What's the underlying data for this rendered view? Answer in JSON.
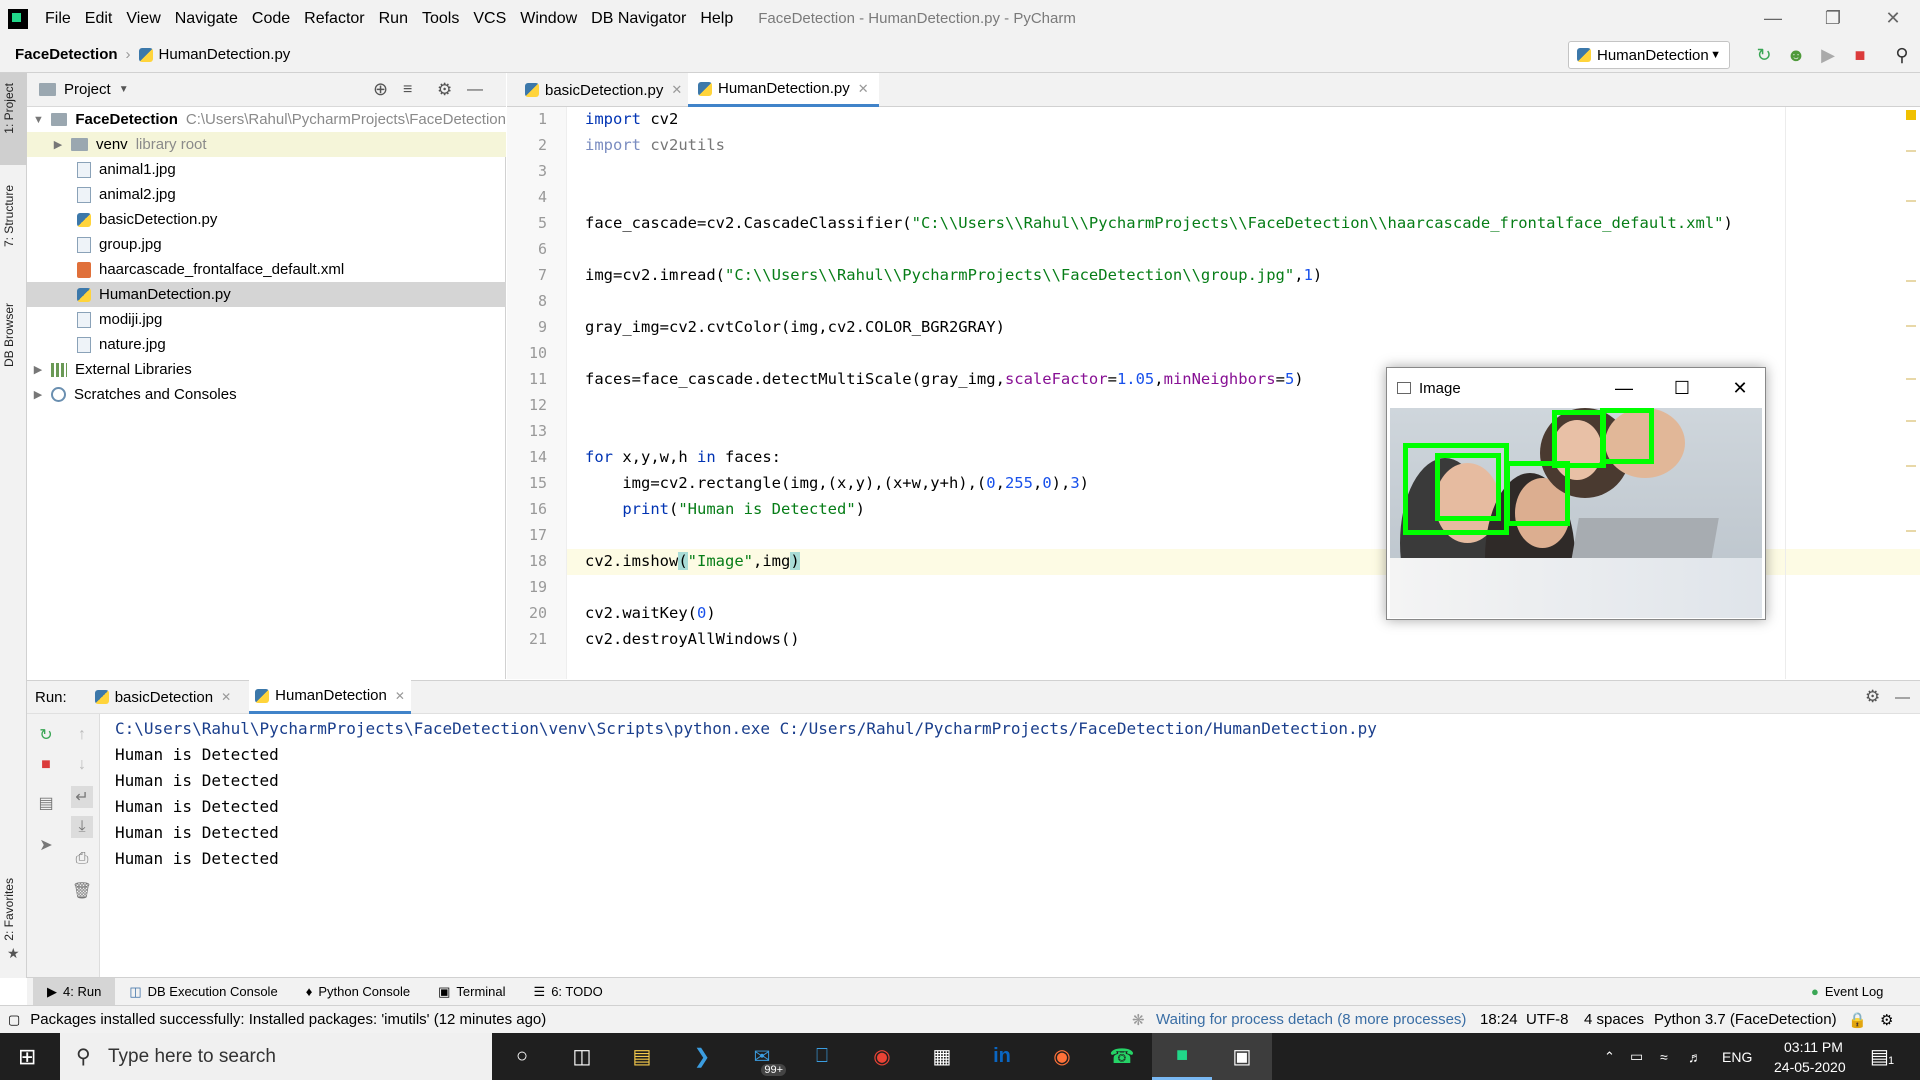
{
  "window": {
    "title": "FaceDetection - HumanDetection.py - PyCharm"
  },
  "menu": [
    "File",
    "Edit",
    "View",
    "Navigate",
    "Code",
    "Refactor",
    "Run",
    "Tools",
    "VCS",
    "Window",
    "DB Navigator",
    "Help"
  ],
  "nav": {
    "project": "FaceDetection",
    "file": "HumanDetection.py",
    "run_config": "HumanDetection"
  },
  "left_strip": {
    "project": "1: Project",
    "structure": "7: Structure",
    "db_browser": "DB Browser",
    "favorites": "2: Favorites"
  },
  "project_panel": {
    "title": "Project",
    "root_name": "FaceDetection",
    "root_path": "C:\\Users\\Rahul\\PycharmProjects\\FaceDetection",
    "venv": "venv",
    "venv_note": "library root",
    "files": [
      "animal1.jpg",
      "animal2.jpg",
      "basicDetection.py",
      "group.jpg",
      "haarcascade_frontalface_default.xml",
      "HumanDetection.py",
      "modiji.jpg",
      "nature.jpg"
    ],
    "external": "External Libraries",
    "scratches": "Scratches and Consoles"
  },
  "editor": {
    "tabs": [
      "basicDetection.py",
      "HumanDetection.py"
    ],
    "line_numbers": [
      "1",
      "2",
      "3",
      "4",
      "5",
      "6",
      "7",
      "8",
      "9",
      "10",
      "11",
      "12",
      "13",
      "14",
      "15",
      "16",
      "17",
      "18",
      "19",
      "20",
      "21"
    ]
  },
  "image_window": {
    "title": "Image"
  },
  "run": {
    "label": "Run:",
    "tabs": [
      "basicDetection",
      "HumanDetection"
    ],
    "command": "C:\\Users\\Rahul\\PycharmProjects\\FaceDetection\\venv\\Scripts\\python.exe C:/Users/Rahul/PycharmProjects/FaceDetection/HumanDetection.py",
    "output": [
      "Human is Detected",
      "Human is Detected",
      "Human is Detected",
      "Human is Detected",
      "Human is Detected"
    ]
  },
  "toolwindows": [
    "4: Run",
    "DB Execution Console",
    "Python Console",
    "Terminal",
    "6: TODO"
  ],
  "event_log": "Event Log",
  "status": {
    "message": "Packages installed successfully: Installed packages: 'imutils' (12 minutes ago)",
    "process": "Waiting for process detach (8 more processes)",
    "position": "18:24",
    "encoding": "UTF-8",
    "indent": "4 spaces",
    "interpreter": "Python 3.7 (FaceDetection)"
  },
  "taskbar": {
    "search_placeholder": "Type here to search",
    "mail_badge": "99+",
    "lang": "ENG",
    "time": "03:11 PM",
    "date": "24-05-2020",
    "notif_count": "1"
  },
  "colors": {
    "keyword": "#0033b3",
    "string": "#067d17",
    "number": "#1750eb",
    "kwarg": "#871094",
    "box": "#00ff00"
  }
}
